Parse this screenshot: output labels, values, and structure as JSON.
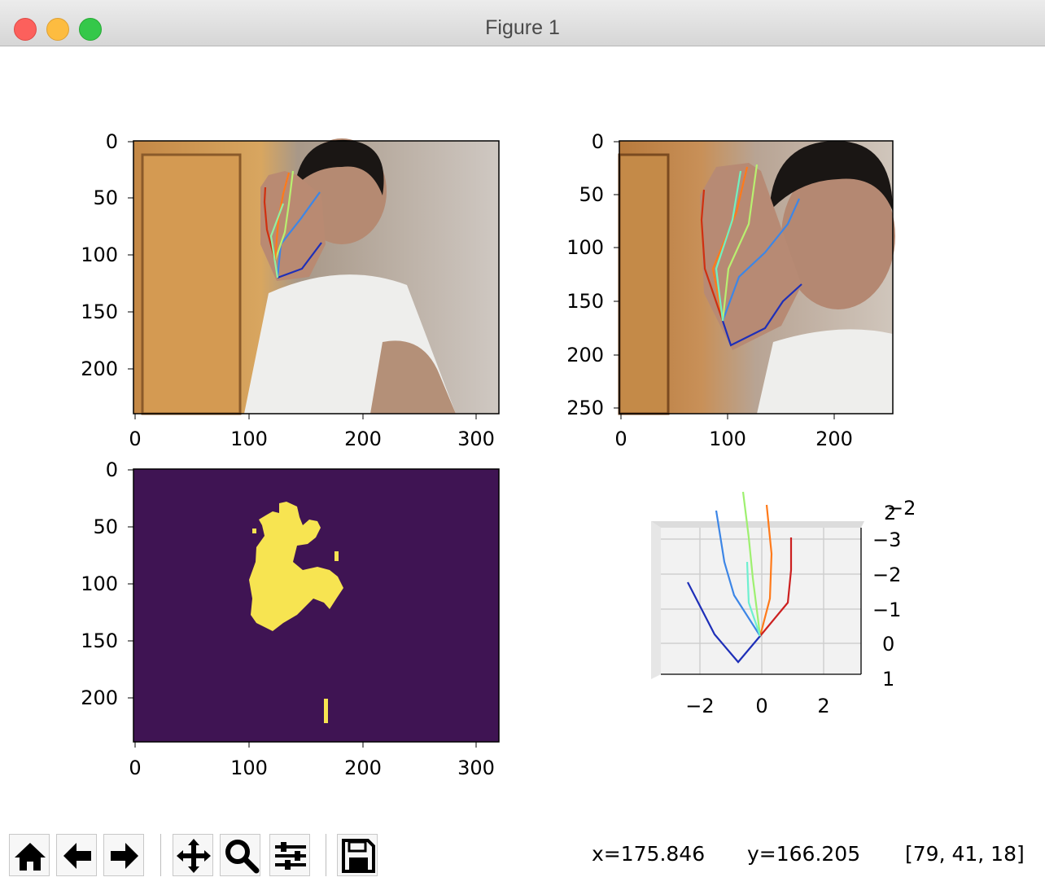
{
  "window": {
    "title": "Figure 1"
  },
  "plots": {
    "img1": {
      "x_ticks": [
        "0",
        "100",
        "200",
        "300"
      ],
      "y_ticks": [
        "0",
        "50",
        "100",
        "150",
        "200"
      ]
    },
    "img2": {
      "x_ticks": [
        "0",
        "100",
        "200"
      ],
      "y_ticks": [
        "0",
        "50",
        "100",
        "150",
        "200",
        "250"
      ]
    },
    "mask": {
      "x_ticks": [
        "0",
        "100",
        "200",
        "300"
      ],
      "y_ticks": [
        "0",
        "50",
        "100",
        "150",
        "200"
      ]
    },
    "plot3d": {
      "x_ticks": [
        "−2",
        "0",
        "2"
      ],
      "z_ticks": [
        "−3",
        "−2",
        "−1",
        "0",
        "1"
      ],
      "top_label": "2",
      "top_label2": "−2"
    }
  },
  "toolbar": {
    "buttons": [
      {
        "name": "home-icon",
        "label": "Home"
      },
      {
        "name": "back-icon",
        "label": "Back"
      },
      {
        "name": "forward-icon",
        "label": "Forward"
      },
      {
        "name": "pan-icon",
        "label": "Pan"
      },
      {
        "name": "zoom-icon",
        "label": "Zoom"
      },
      {
        "name": "configure-subplots-icon",
        "label": "Configure subplots"
      },
      {
        "name": "save-icon",
        "label": "Save"
      }
    ],
    "x_readout": "x=175.846",
    "y_readout": "y=166.205",
    "pixel_readout": "[79, 41, 18]"
  },
  "colors": {
    "mask_bg": "#3f1453",
    "mask_fg": "#f7e451",
    "hand_thumb": "#1e2fb8",
    "hand_index": "#3d86e6",
    "hand_middle": "#7ff0d8",
    "hand_ring": "#ff7a1a",
    "hand_pinky": "#8b0000"
  }
}
